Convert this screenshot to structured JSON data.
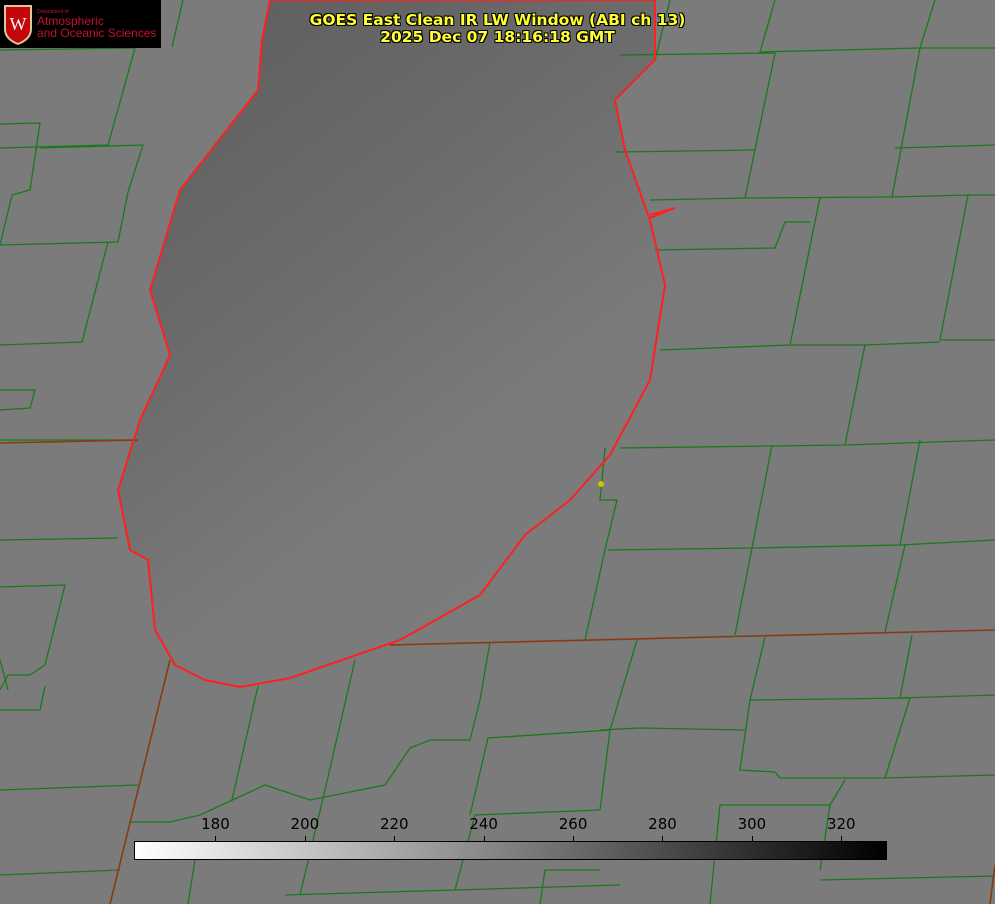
{
  "logo": {
    "dept": "Department of",
    "line1": "Atmospheric",
    "line2": "and Oceanic Sciences"
  },
  "title": {
    "line1": "GOES East Clean IR LW Window (ABI ch 13)",
    "line2": "2025 Dec 07 18:16:18 GMT"
  },
  "colorbar": {
    "min": 162,
    "max": 330,
    "ticks": [
      "180",
      "200",
      "220",
      "240",
      "260",
      "280",
      "300",
      "320"
    ],
    "gradient": [
      "#ffffff",
      "#000000"
    ]
  },
  "colors": {
    "county_lines": "#1a7a1a",
    "shoreline": "#ff2020",
    "background": "#7b7b7b",
    "marker": "#d4c000"
  }
}
